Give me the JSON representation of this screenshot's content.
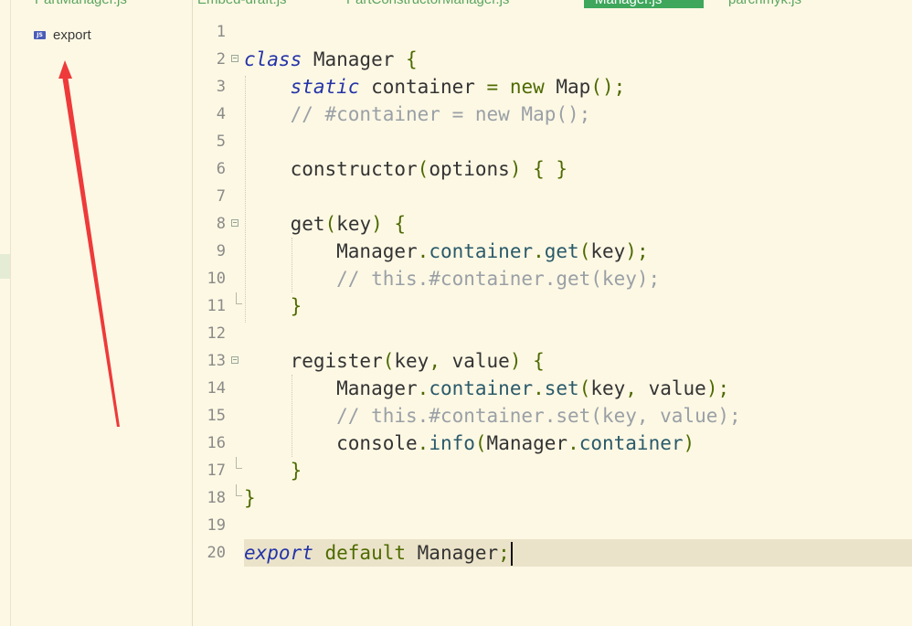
{
  "tabs": [
    {
      "label": "PartManager.js",
      "active": false
    },
    {
      "label": "Embed-draft.js",
      "active": false
    },
    {
      "label": "PartConstructorManager.js",
      "active": false
    },
    {
      "label": "Manager.js",
      "active": true
    },
    {
      "label": "parchmyk.js",
      "active": false
    }
  ],
  "structure": {
    "item_icon": "js-file-icon",
    "item_label": "export"
  },
  "editor": {
    "lines": [
      {
        "n": "1",
        "tokens": []
      },
      {
        "n": "2",
        "tokens": [
          {
            "t": "class",
            "c": "k"
          },
          {
            "t": " Manager ",
            "c": ""
          },
          {
            "t": "{",
            "c": "p"
          }
        ]
      },
      {
        "n": "3",
        "tokens": [
          {
            "t": "    ",
            "c": ""
          },
          {
            "t": "static",
            "c": "k"
          },
          {
            "t": " container ",
            "c": ""
          },
          {
            "t": "=",
            "c": "p"
          },
          {
            "t": " new ",
            "c": "kw"
          },
          {
            "t": "Map",
            "c": ""
          },
          {
            "t": "();",
            "c": "p"
          }
        ]
      },
      {
        "n": "4",
        "tokens": [
          {
            "t": "    // #container = new Map();",
            "c": "c"
          }
        ]
      },
      {
        "n": "5",
        "tokens": []
      },
      {
        "n": "6",
        "tokens": [
          {
            "t": "    constructor",
            "c": ""
          },
          {
            "t": "(",
            "c": "p"
          },
          {
            "t": "options",
            "c": ""
          },
          {
            "t": ")",
            "c": "p"
          },
          {
            "t": " { }",
            "c": "p"
          }
        ]
      },
      {
        "n": "7",
        "tokens": []
      },
      {
        "n": "8",
        "tokens": [
          {
            "t": "    get",
            "c": ""
          },
          {
            "t": "(",
            "c": "p"
          },
          {
            "t": "key",
            "c": ""
          },
          {
            "t": ")",
            "c": "p"
          },
          {
            "t": " {",
            "c": "p"
          }
        ]
      },
      {
        "n": "9",
        "tokens": [
          {
            "t": "        Manager",
            "c": ""
          },
          {
            "t": ".",
            "c": "p"
          },
          {
            "t": "container",
            "c": "m"
          },
          {
            "t": ".",
            "c": "p"
          },
          {
            "t": "get",
            "c": "m"
          },
          {
            "t": "(",
            "c": "p"
          },
          {
            "t": "key",
            "c": ""
          },
          {
            "t": ");",
            "c": "p"
          }
        ]
      },
      {
        "n": "10",
        "tokens": [
          {
            "t": "        // this.#container.get(key);",
            "c": "c"
          }
        ]
      },
      {
        "n": "11",
        "tokens": [
          {
            "t": "    }",
            "c": "p"
          }
        ]
      },
      {
        "n": "12",
        "tokens": []
      },
      {
        "n": "13",
        "tokens": [
          {
            "t": "    register",
            "c": ""
          },
          {
            "t": "(",
            "c": "p"
          },
          {
            "t": "key",
            "c": ""
          },
          {
            "t": ", ",
            "c": "p"
          },
          {
            "t": "value",
            "c": ""
          },
          {
            "t": ")",
            "c": "p"
          },
          {
            "t": " {",
            "c": "p"
          }
        ]
      },
      {
        "n": "14",
        "tokens": [
          {
            "t": "        Manager",
            "c": ""
          },
          {
            "t": ".",
            "c": "p"
          },
          {
            "t": "container",
            "c": "m"
          },
          {
            "t": ".",
            "c": "p"
          },
          {
            "t": "set",
            "c": "m"
          },
          {
            "t": "(",
            "c": "p"
          },
          {
            "t": "key",
            "c": ""
          },
          {
            "t": ", ",
            "c": "p"
          },
          {
            "t": "value",
            "c": ""
          },
          {
            "t": ");",
            "c": "p"
          }
        ]
      },
      {
        "n": "15",
        "tokens": [
          {
            "t": "        // this.#container.set(key, value);",
            "c": "c"
          }
        ]
      },
      {
        "n": "16",
        "tokens": [
          {
            "t": "        console",
            "c": ""
          },
          {
            "t": ".",
            "c": "p"
          },
          {
            "t": "info",
            "c": "m"
          },
          {
            "t": "(",
            "c": "p"
          },
          {
            "t": "Manager",
            "c": ""
          },
          {
            "t": ".",
            "c": "p"
          },
          {
            "t": "container",
            "c": "m"
          },
          {
            "t": ")",
            "c": "p"
          }
        ]
      },
      {
        "n": "17",
        "tokens": [
          {
            "t": "    }",
            "c": "p"
          }
        ]
      },
      {
        "n": "18",
        "tokens": [
          {
            "t": "}",
            "c": "p"
          }
        ]
      },
      {
        "n": "19",
        "tokens": []
      },
      {
        "n": "20",
        "tokens": [
          {
            "t": "export",
            "c": "k"
          },
          {
            "t": " default ",
            "c": "kw"
          },
          {
            "t": "Manager",
            "c": ""
          },
          {
            "t": ";",
            "c": "p"
          }
        ]
      }
    ]
  },
  "colors": {
    "background": "#fdf8e4",
    "keyword": "#2434a8",
    "comment": "#9aa0a6",
    "punctuation": "#4d6a00",
    "active_tab": "#3ea75c",
    "current_line": "#ebe3c9",
    "annotation_arrow": "#ee3a3a"
  }
}
